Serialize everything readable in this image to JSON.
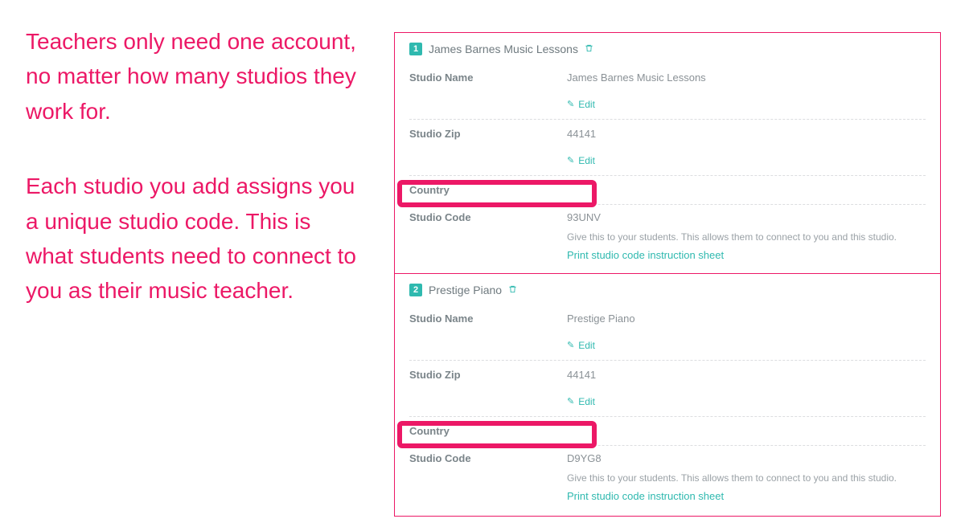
{
  "left": {
    "para1": "Teachers only need one account, no matter how many studios they work for.",
    "para2": "Each studio you add assigns you a unique studio code. This is what students need to connect to you as their music teacher."
  },
  "labels": {
    "studio_name": "Studio Name",
    "studio_zip": "Studio Zip",
    "country": "Country",
    "studio_code": "Studio Code",
    "edit": "Edit",
    "hint": "Give this to your students. This allows them to connect to you and this studio.",
    "print": "Print studio code instruction sheet"
  },
  "studios": [
    {
      "num": "1",
      "title": "James Barnes Music Lessons",
      "name": "James Barnes Music Lessons",
      "zip": "44141",
      "country": "",
      "code": "93UNV"
    },
    {
      "num": "2",
      "title": "Prestige Piano",
      "name": "Prestige Piano",
      "zip": "44141",
      "country": "",
      "code": "D9YG8"
    }
  ]
}
